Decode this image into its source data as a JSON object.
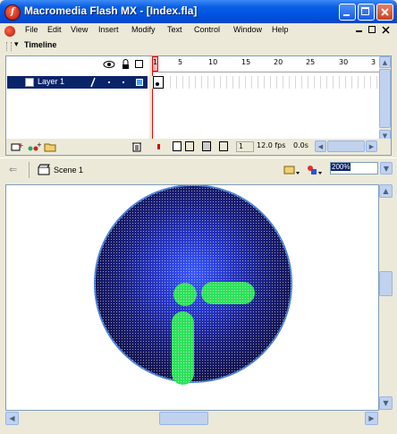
{
  "window": {
    "title": "Macromedia Flash MX - [Index.fla]",
    "app_icon_glyph": "f"
  },
  "menubar": {
    "items": [
      "File",
      "Edit",
      "View",
      "Insert",
      "Modify",
      "Text",
      "Control",
      "Window",
      "Help"
    ]
  },
  "timeline": {
    "panel_title": "Timeline",
    "layer_name": "Layer 1",
    "frame_ticks": [
      "1",
      "5",
      "10",
      "15",
      "20",
      "25",
      "30",
      "3"
    ],
    "current_frame": "1",
    "frame_rate": "12.0 fps",
    "elapsed": "0.0s"
  },
  "editbar": {
    "scene_label": "Scene 1",
    "zoom": "200%"
  },
  "colors": {
    "titlebar": "#0054e3",
    "selection": "#0a246a",
    "circle_outer": "#4a7fd0",
    "circle_fill": "#1a1a66",
    "bar_green": "#2ee05a"
  },
  "icons": {
    "back": "arrow-left-icon",
    "scene": "clapper-icon",
    "edit_symbols": "edit-symbols-icon",
    "edit_scene": "edit-scene-icon",
    "trash": "trash-icon",
    "eye": "eye-icon",
    "lock": "lock-icon",
    "outline": "outline-icon"
  }
}
